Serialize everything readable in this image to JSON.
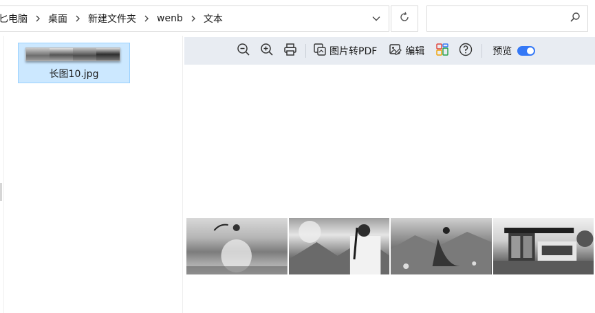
{
  "address_bar": {
    "breadcrumbs": [
      "此电脑",
      "桌面",
      "新建文件夹",
      "wenb",
      "文本"
    ],
    "first_visible": "匕电脑"
  },
  "search": {
    "placeholder": ""
  },
  "file_list": {
    "items": [
      {
        "name": "长图10.jpg",
        "selected": true
      }
    ]
  },
  "preview_toolbar": {
    "zoom_out_icon": "zoom-out-icon",
    "zoom_in_icon": "zoom-in-icon",
    "print_icon": "printer-icon",
    "to_pdf_label": "图片转PDF",
    "edit_label": "编辑",
    "preview_label": "预览",
    "preview_enabled": true
  },
  "colors": {
    "accent": "#3478f6",
    "selection": "#cce8ff",
    "toolbar_bg": "#e8ecf2"
  }
}
